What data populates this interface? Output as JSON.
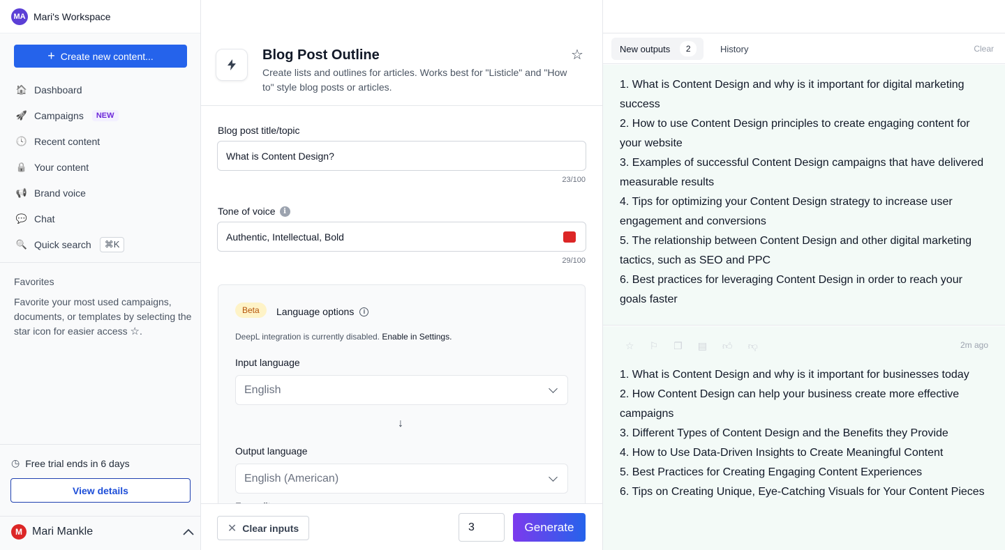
{
  "workspace": {
    "initials": "MA",
    "name": "Mari's Workspace"
  },
  "sidebar": {
    "create_label": "Create new content...",
    "nav": [
      {
        "icon": "home-icon",
        "glyph": "🏠",
        "label": "Dashboard"
      },
      {
        "icon": "rocket-icon",
        "glyph": "🚀",
        "label": "Campaigns",
        "badge": "NEW"
      },
      {
        "icon": "clock-icon",
        "glyph": "🕓",
        "label": "Recent content"
      },
      {
        "icon": "lock-icon",
        "glyph": "🔒",
        "label": "Your content"
      },
      {
        "icon": "megaphone-icon",
        "glyph": "📢",
        "label": "Brand voice"
      },
      {
        "icon": "chat-icon",
        "glyph": "💬",
        "label": "Chat"
      },
      {
        "icon": "search-icon",
        "glyph": "🔍",
        "label": "Quick search",
        "shortcut": "⌘K"
      }
    ],
    "favorites_title": "Favorites",
    "favorites_text": "Favorite your most used campaigns, documents, or templates by selecting the star icon for easier access",
    "favorites_text_end": ".",
    "trial_text": "Free trial ends in 6 days",
    "view_details": "View details",
    "user": {
      "initial": "M",
      "name": "Mari Mankle"
    }
  },
  "tool": {
    "title": "Blog Post Outline",
    "description": "Create lists and outlines for articles. Works best for \"Listicle\" and \"How to\" style blog posts or articles.",
    "topic_label": "Blog post title/topic",
    "topic_value": "What is Content Design?",
    "topic_counter": "23/100",
    "tone_label": "Tone of voice",
    "tone_value": "Authentic, Intellectual, Bold",
    "tone_counter": "29/100",
    "beta": "Beta",
    "lang_title": "Language options",
    "deepl_note": "DeepL integration is currently disabled.",
    "deepl_link": "Enable in Settings.",
    "input_lang_label": "Input language",
    "input_lang": "English",
    "output_lang_label": "Output language",
    "output_lang": "English (American)",
    "formality_partial": "Formality",
    "clear_inputs": "Clear inputs",
    "count": "3",
    "generate": "Generate"
  },
  "outputs": {
    "tab_new": "New outputs",
    "tab_new_count": "2",
    "tab_history": "History",
    "clear": "Clear",
    "time_ago": "2m ago",
    "first": [
      "1. What is Content Design and why is it important for digital marketing success",
      "2. How to use Content Design principles to create engaging content for your website",
      "3. Examples of successful Content Design campaigns that have delivered measurable results",
      "4. Tips for optimizing your Content Design strategy to increase user engagement and conversions",
      "5. The relationship between Content Design and other digital marketing tactics, such as SEO and PPC",
      "6. Best practices for leveraging Content Design in order to reach your goals faster"
    ],
    "second": [
      "1. What is Content Design and why is it important for businesses today",
      "2. How Content Design can help your business create more effective campaigns",
      "3. Different Types of Content Design and the Benefits they Provide",
      "4. How to Use Data-Driven Insights to Create Meaningful Content",
      "5. Best Practices for Creating Engaging Content Experiences",
      "6. Tips on Creating Unique, Eye-Catching Visuals for Your Content Pieces"
    ]
  }
}
